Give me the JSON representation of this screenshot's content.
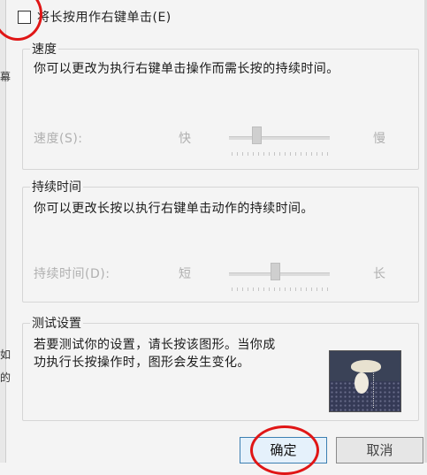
{
  "left_edge_chars": [
    "幕",
    "如",
    "的"
  ],
  "long_press": {
    "checkbox_checked": false,
    "checkbox_label": "将长按用作右键单击(E)"
  },
  "speed": {
    "title": "速度",
    "description": "你可以更改为执行右键单击操作而需长按的持续时间。",
    "slider_label": "速度(S):",
    "fast_label": "快",
    "slow_label": "慢"
  },
  "duration": {
    "title": "持续时间",
    "description": "你可以更改长按以执行右键单击动作的持续时间。",
    "slider_label": "持续时间(D):",
    "short_label": "短",
    "long_label": "长"
  },
  "test": {
    "title": "测试设置",
    "description_line1": "若要测试你的设置，请长按该图形。当你成",
    "description_line2": "功执行长按操作时，图形会发生变化。"
  },
  "buttons": {
    "ok_label": "确定",
    "cancel_label": "取消"
  },
  "annotation_color": "#e01616"
}
